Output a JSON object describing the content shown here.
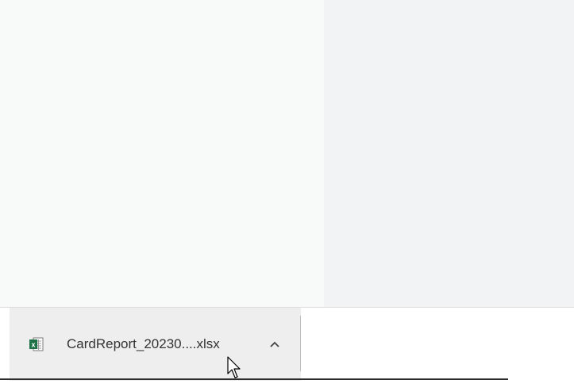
{
  "download_bar": {
    "file_name": "CardReport_20230....xlsx",
    "file_icon": "excel-file-icon",
    "expand_icon": "chevron-up-icon"
  },
  "colors": {
    "left_pane": "#f8f9f9",
    "right_pane": "#f2f3f5",
    "shelf_item_bg": "#eeeeee",
    "excel_green": "#1e7145"
  }
}
